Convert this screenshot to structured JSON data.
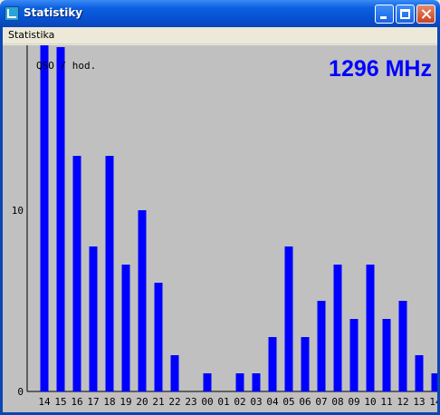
{
  "window": {
    "title": "Statistiky"
  },
  "menu": {
    "items": [
      "Statistika"
    ]
  },
  "frequency_label": "1296 MHz",
  "chart_data": {
    "type": "bar",
    "ylabel": "QSO / hod.",
    "yticks": [
      0,
      10
    ],
    "ylim": [
      0,
      19
    ],
    "grid": false,
    "bar_color": "#0000ff",
    "background": "#c0c0c0",
    "categories": [
      "14",
      "15",
      "16",
      "17",
      "18",
      "19",
      "20",
      "21",
      "22",
      "23",
      "00",
      "01",
      "02",
      "03",
      "04",
      "05",
      "06",
      "07",
      "08",
      "09",
      "10",
      "11",
      "12",
      "13",
      "14"
    ],
    "values": [
      20,
      19,
      13,
      8,
      13,
      7,
      10,
      6,
      2,
      0,
      1,
      0,
      1,
      1,
      3,
      8,
      3,
      5,
      7,
      4,
      7,
      4,
      5,
      2,
      1
    ]
  }
}
